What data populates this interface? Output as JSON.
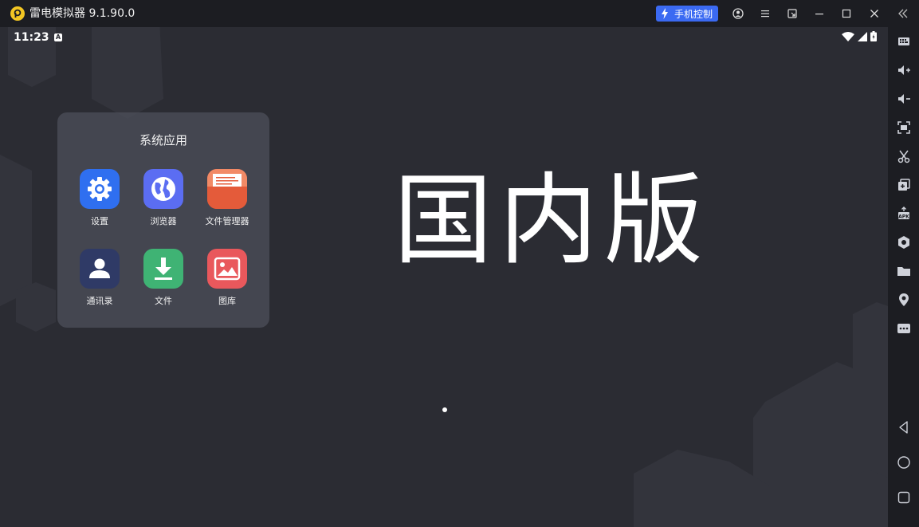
{
  "window": {
    "title": "雷电模拟器 9.1.90.0",
    "phone_control_label": "手机控制"
  },
  "status_bar": {
    "time": "11:23",
    "badge": "A"
  },
  "folder": {
    "title": "系统应用",
    "apps": [
      {
        "label": "设置",
        "icon": "settings-icon",
        "color": "#2f6ff0"
      },
      {
        "label": "浏览器",
        "icon": "globe-icon",
        "color": "#5b6df2"
      },
      {
        "label": "文件管理器",
        "icon": "file-manager-icon",
        "color": "#e45b3a"
      },
      {
        "label": "通讯录",
        "icon": "contacts-icon",
        "color": "#2f3a66"
      },
      {
        "label": "文件",
        "icon": "download-icon",
        "color": "#3fb374"
      },
      {
        "label": "图库",
        "icon": "gallery-icon",
        "color": "#e9585c"
      }
    ]
  },
  "main": {
    "big_text": "国内版"
  },
  "sidebar": {
    "icons": [
      "keyboard-icon",
      "volume-up-icon",
      "volume-down-icon",
      "screenshot-icon",
      "scissors-icon",
      "multi-instance-icon",
      "apk-install-icon",
      "settings-hex-icon",
      "folder-icon",
      "location-icon",
      "more-icon",
      "back-icon",
      "home-icon",
      "recents-icon"
    ]
  },
  "colors": {
    "accent": "#3b6af2",
    "logo": "#f3c623",
    "screen_bg": "#2b2c33"
  }
}
